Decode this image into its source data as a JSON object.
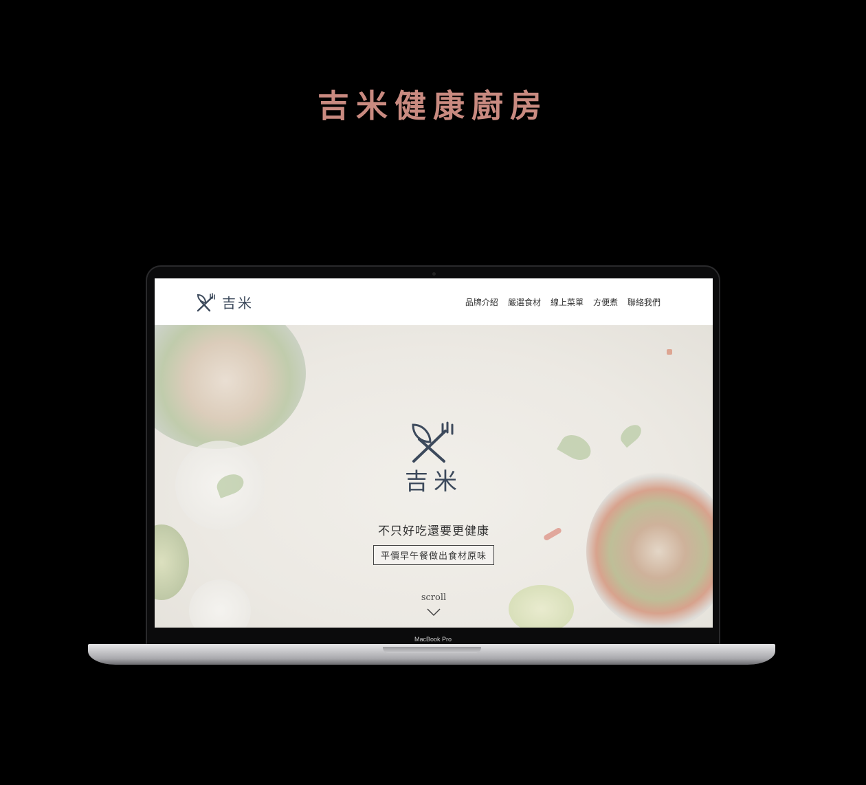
{
  "heading": "吉米健康廚房",
  "device": {
    "model_label": "MacBook Pro"
  },
  "site": {
    "brand": "吉米",
    "nav": [
      "品牌介紹",
      "嚴選食材",
      "線上菜單",
      "方便煮",
      "聯絡我們"
    ],
    "hero": {
      "brand": "吉米",
      "tagline": "不只好吃還要更健康",
      "subtitle": "平價早午餐做出食材原味",
      "scroll_label": "scroll"
    }
  },
  "colors": {
    "heading": "#c98a80",
    "logo": "#3d4a5c",
    "hero_bg": "#eeebe6"
  },
  "icons": [
    "leaf-fork-logo-icon",
    "chevron-down-icon"
  ]
}
